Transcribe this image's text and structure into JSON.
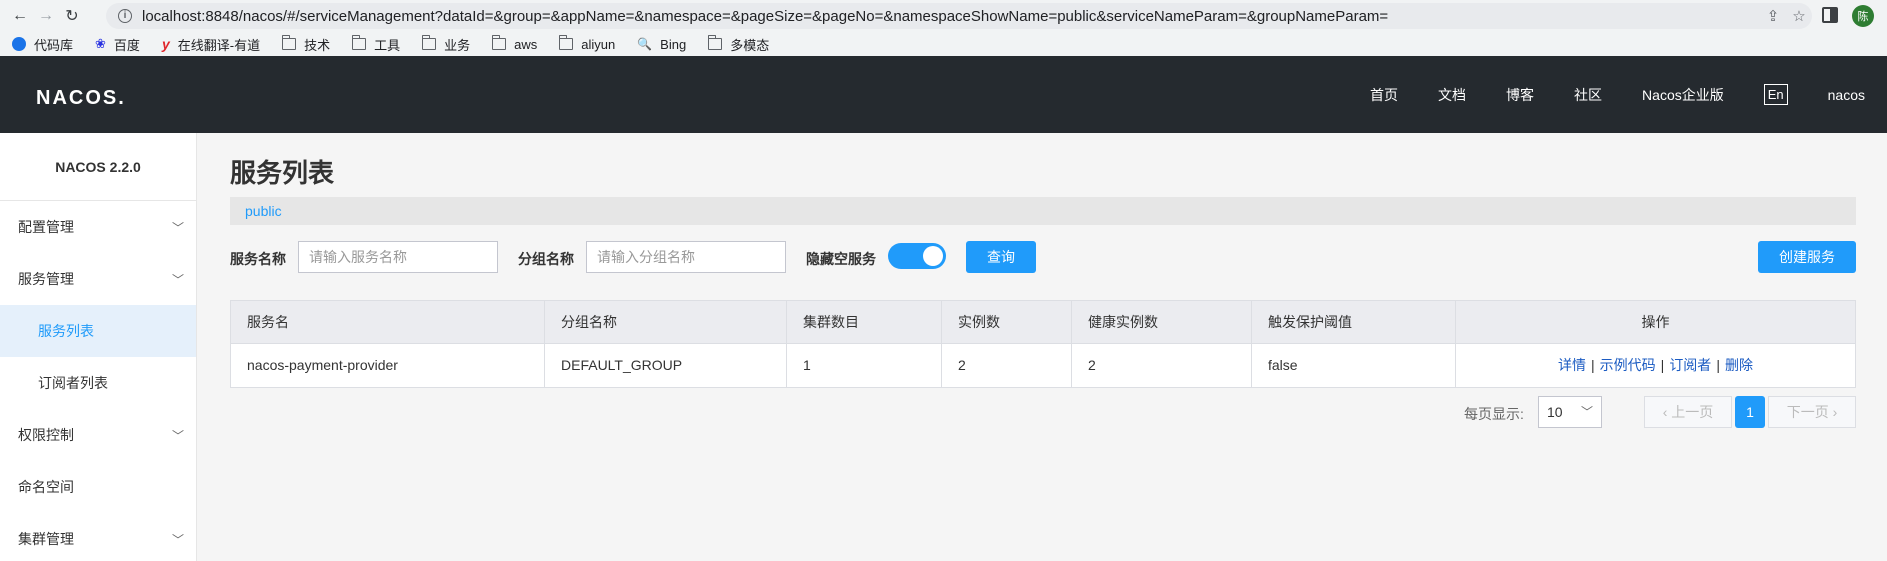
{
  "browser": {
    "url": "localhost:8848/nacos/#/serviceManagement?dataId=&group=&appName=&namespace=&pageSize=&pageNo=&namespaceShowName=public&serviceNameParam=&groupNameParam=",
    "profile_initial": "陈",
    "bookmarks": [
      "代码库",
      "百度",
      "在线翻译-有道",
      "技术",
      "工具",
      "业务",
      "aws",
      "aliyun",
      "Bing",
      "多模态"
    ]
  },
  "header": {
    "logo": "NACOS.",
    "nav": [
      "首页",
      "文档",
      "博客",
      "社区",
      "Nacos企业版"
    ],
    "lang": "En",
    "user": "nacos"
  },
  "sidebar": {
    "version": "NACOS 2.2.0",
    "items": [
      {
        "label": "配置管理"
      },
      {
        "label": "服务管理"
      },
      {
        "label": "服务列表"
      },
      {
        "label": "订阅者列表"
      },
      {
        "label": "权限控制"
      },
      {
        "label": "命名空间"
      },
      {
        "label": "集群管理"
      }
    ]
  },
  "main": {
    "title": "服务列表",
    "namespace": "public",
    "filters": {
      "service_label": "服务名称",
      "service_placeholder": "请输入服务名称",
      "group_label": "分组名称",
      "group_placeholder": "请输入分组名称",
      "hide_empty_label": "隐藏空服务",
      "hide_empty_on": true,
      "query_button": "查询",
      "create_button": "创建服务"
    },
    "table": {
      "columns": [
        "服务名",
        "分组名称",
        "集群数目",
        "实例数",
        "健康实例数",
        "触发保护阈值",
        "操作"
      ],
      "rows": [
        [
          "nacos-payment-provider",
          "DEFAULT_GROUP",
          "1",
          "2",
          "2",
          "false"
        ]
      ],
      "actions": [
        "详情",
        "示例代码",
        "订阅者",
        "删除"
      ]
    },
    "pagination": {
      "page_size_label": "每页显示:",
      "page_size": "10",
      "prev": "上一页",
      "current": "1",
      "next": "下一页"
    }
  }
}
